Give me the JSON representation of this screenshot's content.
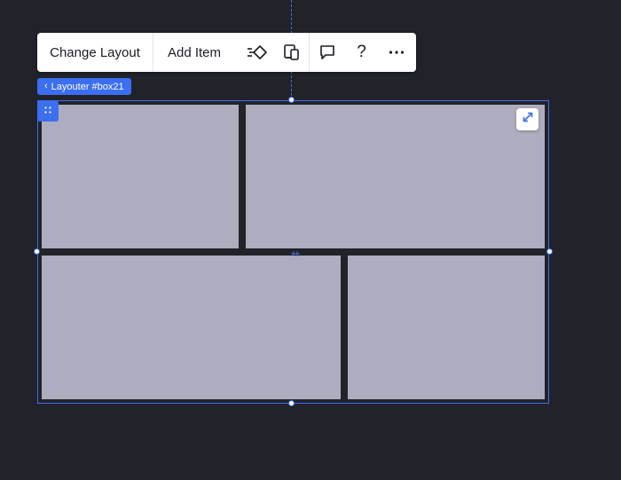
{
  "toolbar": {
    "change_layout_label": "Change Layout",
    "add_item_label": "Add Item",
    "icons": [
      "animation-icon",
      "responsive-devices-icon",
      "comment-icon",
      "help-icon",
      "more-icon"
    ],
    "help_glyph": "?"
  },
  "breadcrumb": {
    "label": "Layouter #box21",
    "chevron": "‹"
  },
  "layouter": {
    "cells": [
      "cell-1",
      "cell-2",
      "cell-3",
      "cell-4"
    ]
  },
  "colors": {
    "background": "#22222a",
    "accent": "#3b6ef0",
    "cell": "#aeadbf",
    "toolbar": "#ffffff",
    "text": "#1b1c22"
  }
}
